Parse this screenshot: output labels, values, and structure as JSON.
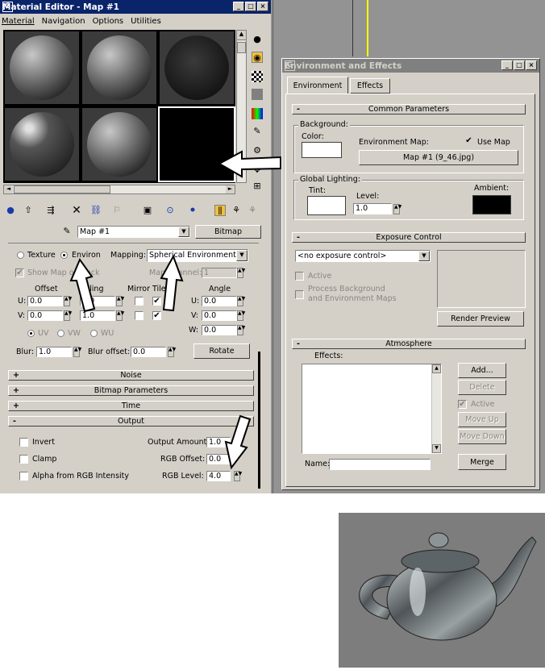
{
  "material_editor": {
    "title": "Material Editor - Map #1",
    "menu": [
      "Material",
      "Navigation",
      "Options",
      "Utilities"
    ],
    "map_name": "Map #1",
    "map_type_button": "Bitmap",
    "coords": {
      "texture_label": "Texture",
      "environ_label": "Environ",
      "mapping_label": "Mapping:",
      "mapping_value": "Spherical Environment",
      "show_map_label": "Show Map on Back",
      "map_channel_label": "Map Channel:",
      "map_channel_value": "1",
      "offset_label": "Offset",
      "tiling_label": "Tiling",
      "mirror_tile_label": "Mirror Tile",
      "angle_label": "Angle",
      "u_label": "U:",
      "v_label": "V:",
      "w_label": "W:",
      "u_offset": "0.0",
      "v_offset": "0.0",
      "u_tiling": "1.0",
      "v_tiling": "1.0",
      "u_angle": "0.0",
      "v_angle": "0.0",
      "w_angle": "0.0",
      "uv": "UV",
      "vw": "VW",
      "wu": "WU",
      "blur_label": "Blur:",
      "blur_value": "1.0",
      "blur_offset_label": "Blur offset:",
      "blur_offset_value": "0.0",
      "rotate_button": "Rotate"
    },
    "rollouts": [
      {
        "sign": "+",
        "label": "Noise"
      },
      {
        "sign": "+",
        "label": "Bitmap Parameters"
      },
      {
        "sign": "+",
        "label": "Time"
      },
      {
        "sign": "-",
        "label": "Output"
      }
    ],
    "output": {
      "invert": "Invert",
      "clamp": "Clamp",
      "alpha": "Alpha from RGB Intensity",
      "amount_label": "Output Amount:",
      "amount_value": "1.0",
      "offset_label": "RGB Offset:",
      "offset_value": "0.0",
      "level_label": "RGB Level:",
      "level_value": "4.0"
    }
  },
  "env_dialog": {
    "title": "Environment and Effects",
    "tabs": [
      "Environment",
      "Effects"
    ],
    "common_params": "Common Parameters",
    "background_label": "Background:",
    "color_label": "Color:",
    "env_map_label": "Environment Map:",
    "use_map_label": "Use Map",
    "env_map_button": "Map #1 (9_46.jpg)",
    "global_lighting_label": "Global Lighting:",
    "tint_label": "Tint:",
    "level_label": "Level:",
    "level_value": "1.0",
    "ambient_label": "Ambient:",
    "exposure_control": "Exposure Control",
    "exposure_value": "<no exposure control>",
    "active_label": "Active",
    "process_bg_label": "Process Background and Environment Maps",
    "render_preview": "Render Preview",
    "atmosphere": "Atmosphere",
    "effects_label": "Effects:",
    "add": "Add...",
    "delete": "Delete",
    "atm_active": "Active",
    "move_up": "Move Up",
    "move_down": "Move Down",
    "name_label": "Name:",
    "merge": "Merge"
  },
  "colors": {
    "title_active": "#0a246a",
    "title_inactive": "#808080",
    "panel": "#d4d0c8",
    "viewport": "#939393"
  }
}
